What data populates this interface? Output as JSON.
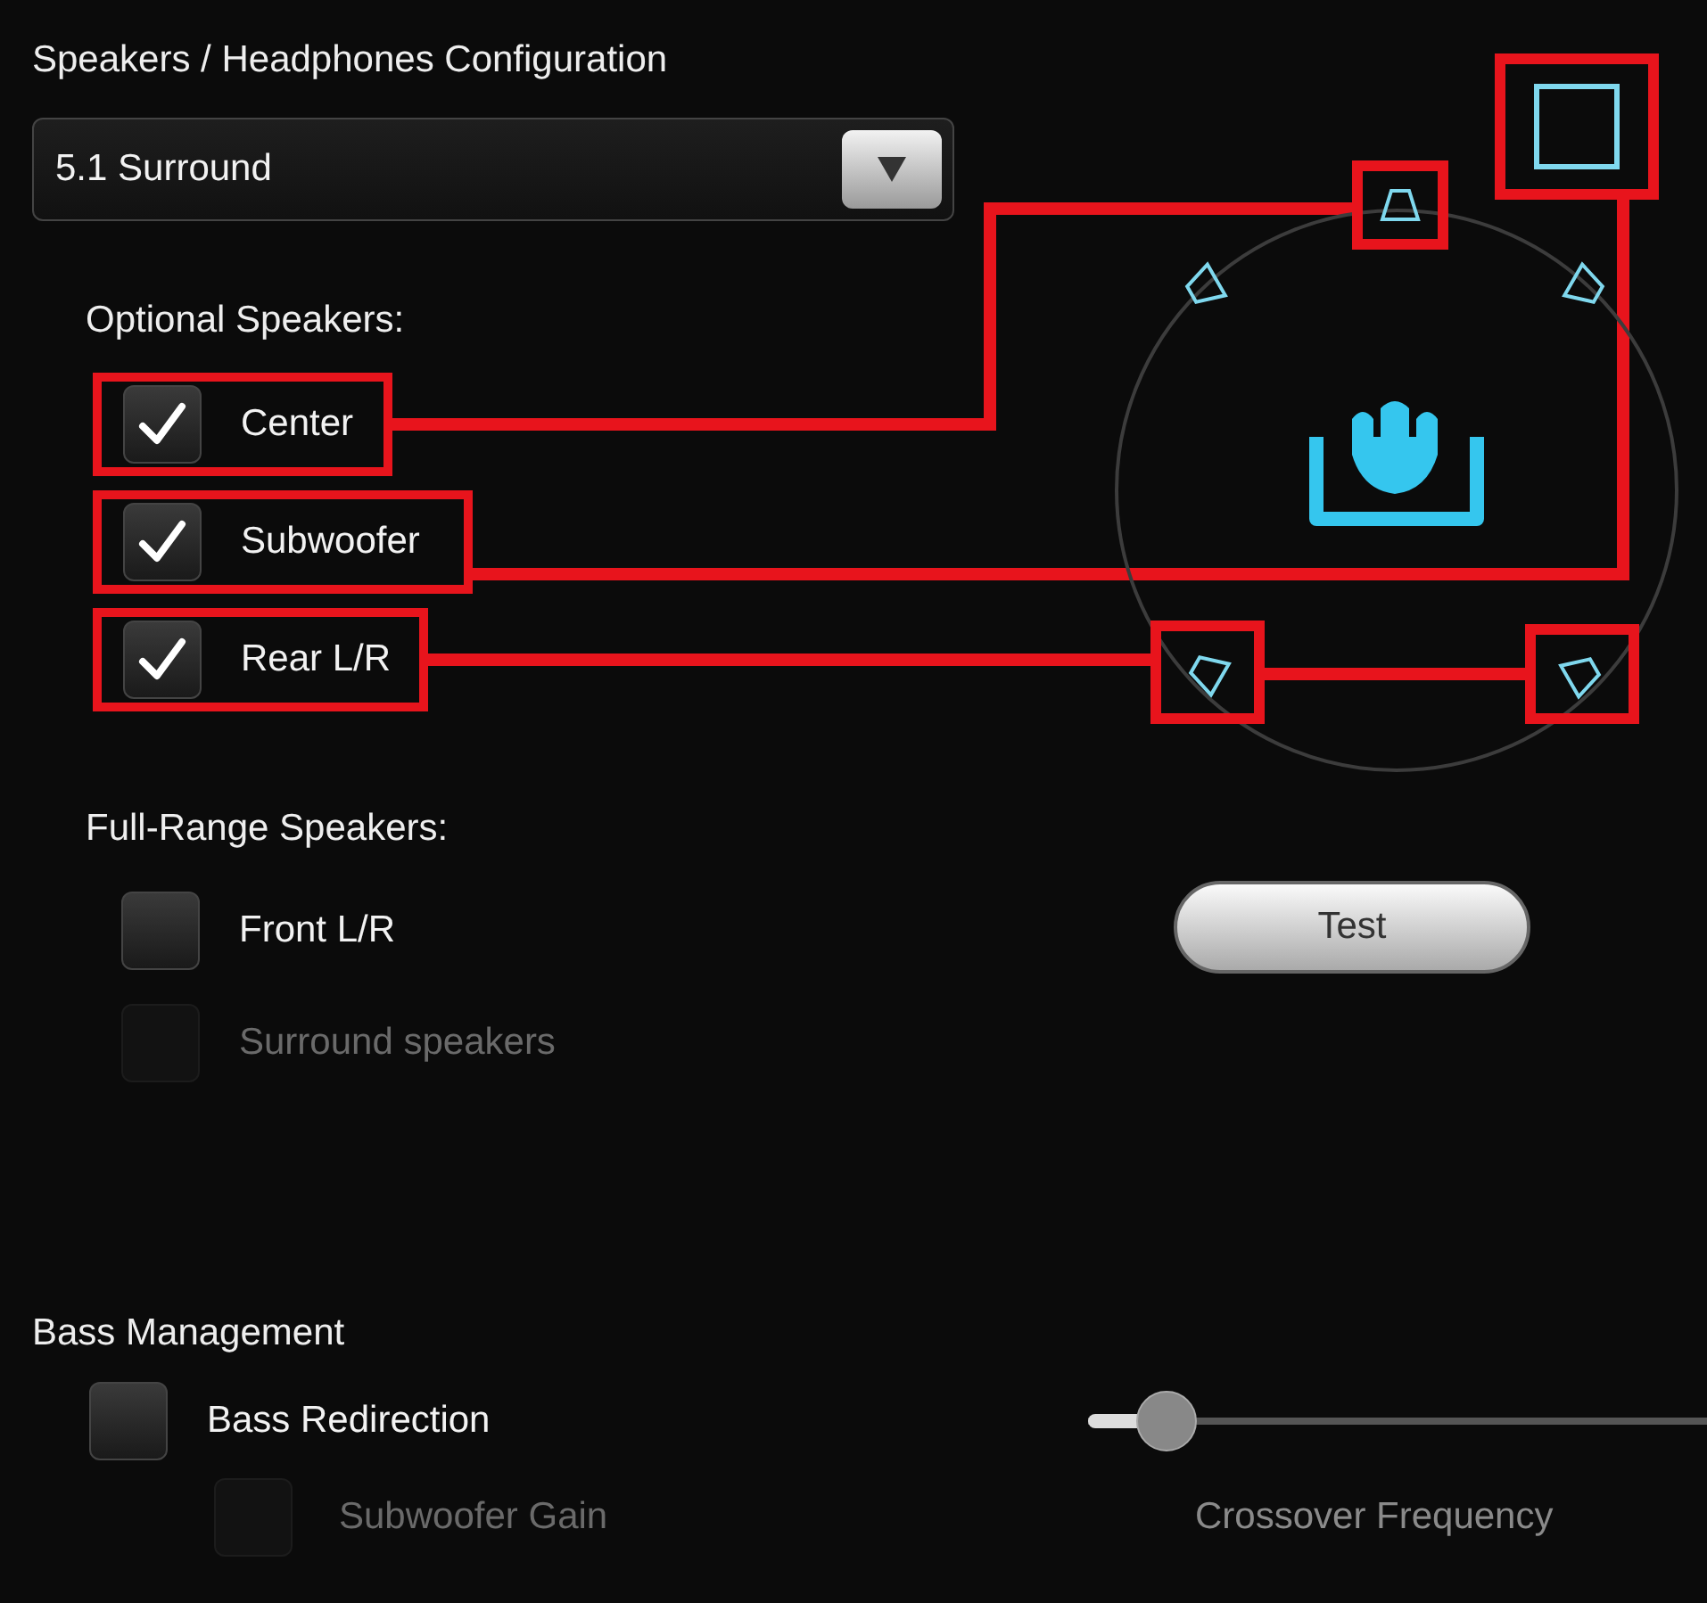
{
  "config": {
    "title": "Speakers / Headphones Configuration",
    "value": "5.1 Surround"
  },
  "optional": {
    "title": "Optional Speakers:",
    "items": [
      {
        "label": "Center",
        "checked": true,
        "disabled": false
      },
      {
        "label": "Subwoofer",
        "checked": true,
        "disabled": false
      },
      {
        "label": "Rear L/R",
        "checked": true,
        "disabled": false
      }
    ]
  },
  "full_range": {
    "title": "Full-Range Speakers:",
    "items": [
      {
        "label": "Front L/R",
        "checked": false,
        "disabled": false
      },
      {
        "label": "Surround speakers",
        "checked": false,
        "disabled": true
      }
    ]
  },
  "test_button": "Test",
  "bass": {
    "title": "Bass Management",
    "redirection": {
      "label": "Bass Redirection",
      "checked": false,
      "disabled": false
    },
    "gain": {
      "label": "Subwoofer Gain",
      "checked": false,
      "disabled": true
    },
    "crossover": {
      "label": "Crossover Frequency",
      "level": 0.1
    }
  }
}
